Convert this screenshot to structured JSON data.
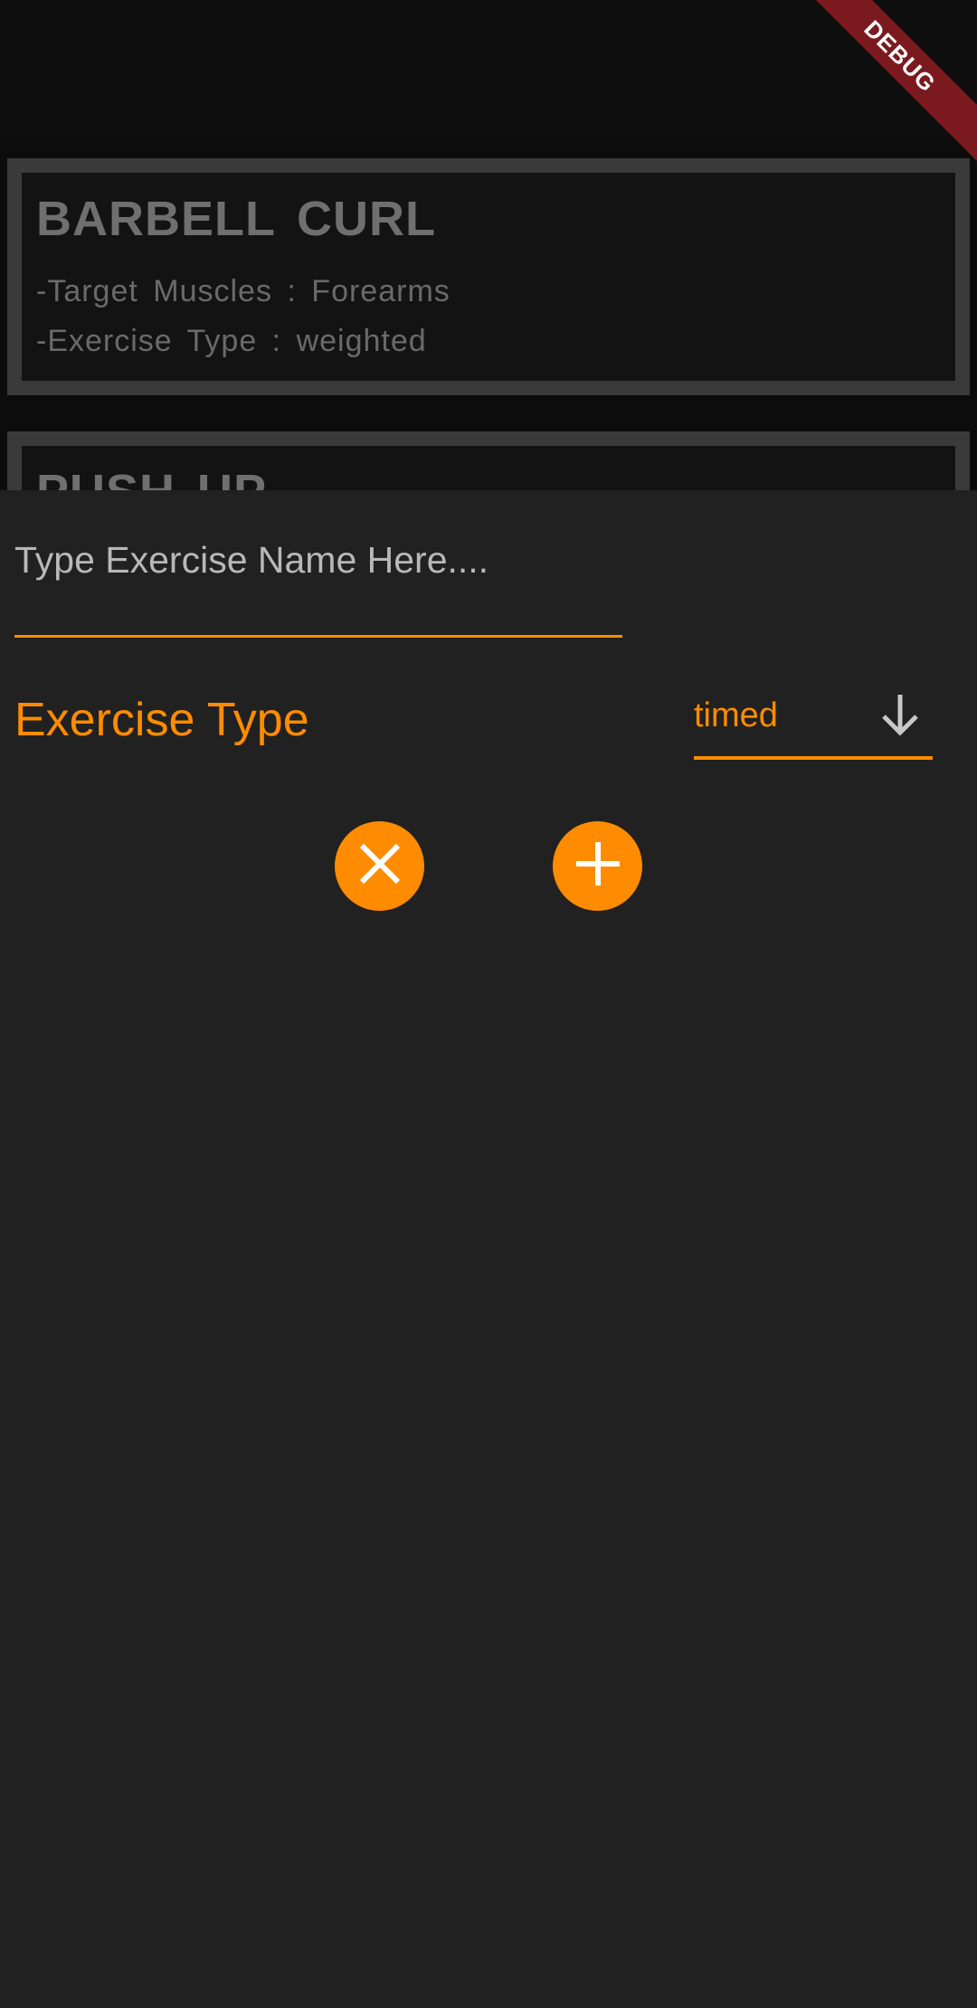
{
  "debug_banner": {
    "label": "DEBUG",
    "color": "#7a1a1f"
  },
  "exercise_list": [
    {
      "title": "BARBELL  CURL",
      "target_line": "-Target  Muscles  :  Forearms",
      "type_line": "-Exercise  Type     :  weighted"
    },
    {
      "title": "PUSH UP"
    }
  ],
  "add_exercise_sheet": {
    "name_input": {
      "value": "",
      "placeholder": "Type Exercise Name Here...."
    },
    "exercise_type_label": "Exercise Type",
    "exercise_type_dropdown": {
      "selected": "timed",
      "icon": "arrow-down-icon"
    },
    "cancel_button": {
      "icon": "close-icon"
    },
    "add_button": {
      "icon": "plus-icon"
    }
  },
  "colors": {
    "accent": "#ff8c00",
    "sheet_background": "#212121",
    "list_background": "#0c0c0c",
    "card_border": "#3a3a3a"
  }
}
